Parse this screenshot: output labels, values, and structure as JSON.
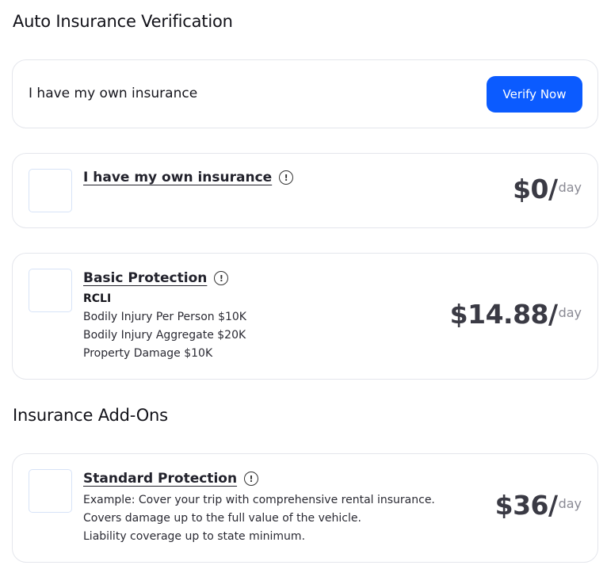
{
  "section_titles": {
    "auto_insurance": "Auto Insurance Verification",
    "add_ons": "Insurance Add-Ons"
  },
  "verify": {
    "label": "I have my own insurance",
    "button_label": "Verify Now"
  },
  "options": {
    "own_insurance": {
      "title": "I have my own insurance",
      "info_icon": "!",
      "price": "$0/",
      "unit": "day"
    },
    "basic": {
      "title": "Basic Protection",
      "info_icon": "!",
      "lines": [
        "RCLI",
        "Bodily Injury Per Person $10K",
        "Bodily Injury Aggregate $20K",
        "Property Damage $10K"
      ],
      "price": "$14.88/",
      "unit": "day"
    },
    "standard": {
      "title": "Standard Protection",
      "info_icon": "!",
      "lines": [
        "Example: Cover your trip with comprehensive rental insurance.",
        "Covers damage up to the full value of the vehicle.",
        "Liability coverage up to state minimum."
      ],
      "price": "$36/",
      "unit": "day"
    }
  },
  "colors": {
    "accent": "#0b5bff",
    "card_border": "#e4e6ec",
    "checkbox_border": "#d7e3f7"
  }
}
